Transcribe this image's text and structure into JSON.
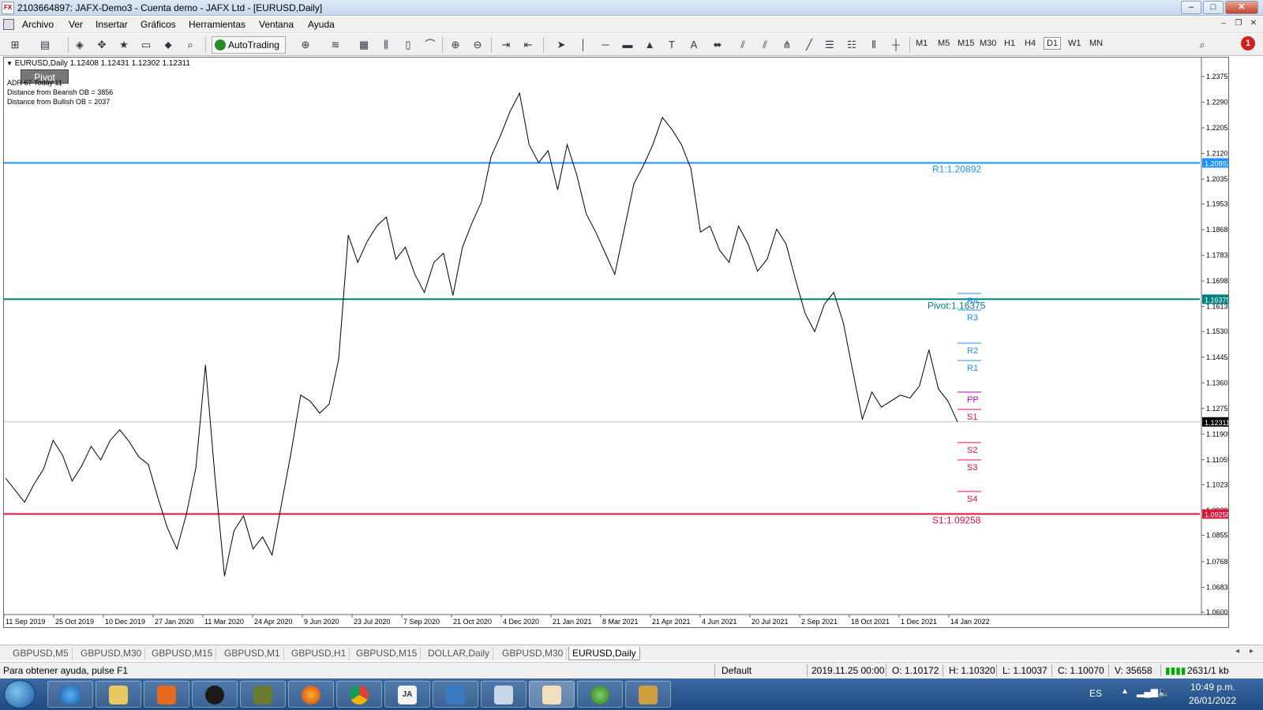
{
  "window": {
    "title": "2103664897: JAFX-Demo3 - Cuenta demo - JAFX Ltd - [EURUSD,Daily]",
    "app_icon_text": "FX"
  },
  "menu": [
    "Archivo",
    "Ver",
    "Insertar",
    "Gráficos",
    "Herramientas",
    "Ventana",
    "Ayuda"
  ],
  "toolbar": {
    "autotrading_label": "AutoTrading",
    "timeframes": [
      "M1",
      "M5",
      "M15",
      "M30",
      "H1",
      "H4",
      "D1",
      "W1",
      "MN"
    ],
    "active_timeframe": "D1",
    "alert_count": "1"
  },
  "chart": {
    "symbol_header": "EURUSD,Daily  1.12408 1.12431 1.12302 1.12311",
    "pivot_button": "Pivot",
    "adr_line": "ADR 67   Today 11",
    "bearish_ob_line": "Distance from Bearish OB = 3856",
    "bullish_ob_line": "Distance from Bullish OB = 2037",
    "price_badges": {
      "r1": "1.20892",
      "pivot": "1.16375",
      "current": "1.12311",
      "s1": "1.09258"
    },
    "labels": {
      "r1": "R1:1.20892",
      "pivot": "Pivot:1.16375",
      "s1": "S1:1.09258"
    },
    "level_tags": [
      "R4",
      "R3",
      "R2",
      "R1",
      "PP",
      "S1",
      "S2",
      "S3",
      "S4"
    ],
    "colors": {
      "r1_line": "#1e90ff",
      "pivot_line": "#008080",
      "s1_line": "#dc143c",
      "pp_tag": "#c000c0"
    }
  },
  "chart_data": {
    "type": "line",
    "title": "EURUSD,Daily",
    "xlabel": "",
    "ylabel": "",
    "x_tick_labels": [
      "11 Sep 2019",
      "25 Oct 2019",
      "10 Dec 2019",
      "27 Jan 2020",
      "11 Mar 2020",
      "24 Apr 2020",
      "9 Jun 2020",
      "23 Jul 2020",
      "7 Sep 2020",
      "21 Oct 2020",
      "4 Dec 2020",
      "21 Jan 2021",
      "8 Mar 2021",
      "21 Apr 2021",
      "4 Jun 2021",
      "20 Jul 2021",
      "2 Sep 2021",
      "18 Oct 2021",
      "1 Dec 2021",
      "14 Jan 2022"
    ],
    "y_tick_labels": [
      "1.23755",
      "1.22905",
      "1.22055",
      "1.21205",
      "1.20355",
      "1.19530",
      "1.18680",
      "1.17830",
      "1.16980",
      "1.16130",
      "1.15305",
      "1.14455",
      "1.13605",
      "1.12755",
      "1.11905",
      "1.11055",
      "1.10230",
      "1.09380",
      "1.08555",
      "1.07680",
      "1.06830",
      "1.06005"
    ],
    "ylim": [
      1.06005,
      1.23755
    ],
    "grid": false,
    "series": [
      {
        "values": [
          1.1045,
          1.1005,
          1.0965,
          1.1025,
          1.1075,
          1.117,
          1.112,
          1.1035,
          1.1085,
          1.115,
          1.1105,
          1.117,
          1.1205,
          1.1165,
          1.1115,
          1.109,
          1.098,
          1.088,
          1.081,
          1.0925,
          1.108,
          1.142,
          1.105,
          1.072,
          1.087,
          1.092,
          1.081,
          1.085,
          1.079,
          1.096,
          1.113,
          1.132,
          1.13,
          1.126,
          1.129,
          1.144,
          1.185,
          1.176,
          1.183,
          1.188,
          1.191,
          1.177,
          1.181,
          1.172,
          1.166,
          1.176,
          1.179,
          1.165,
          1.181,
          1.189,
          1.196,
          1.211,
          1.218,
          1.226,
          1.232,
          1.215,
          1.209,
          1.213,
          1.2,
          1.215,
          1.205,
          1.192,
          1.186,
          1.179,
          1.172,
          1.187,
          1.202,
          1.208,
          1.215,
          1.224,
          1.22,
          1.215,
          1.207,
          1.186,
          1.188,
          1.18,
          1.176,
          1.188,
          1.182,
          1.173,
          1.177,
          1.187,
          1.182,
          1.17,
          1.159,
          1.153,
          1.162,
          1.166,
          1.156,
          1.14,
          1.124,
          1.133,
          1.128,
          1.13,
          1.132,
          1.131,
          1.135,
          1.147,
          1.134,
          1.13,
          1.1231
        ]
      }
    ],
    "levels": {
      "R1": 1.20892,
      "Pivot": 1.16375,
      "S1": 1.09258,
      "current": 1.12311
    }
  },
  "tabs": [
    "GBPUSD,M5",
    "GBPUSD,M30",
    "GBPUSD,M15",
    "GBPUSD,M1",
    "GBPUSD,H1",
    "GBPUSD,M15",
    "DOLLAR,Daily",
    "GBPUSD,M30",
    "EURUSD,Daily"
  ],
  "active_tab": "EURUSD,Daily",
  "status": {
    "help": "Para obtener ayuda, pulse F1",
    "profile": "Default",
    "datetime": "2019.11.25 00:00",
    "open": "O: 1.10172",
    "high": "H: 1.10320",
    "low": "L: 1.10037",
    "close": "C: 1.10070",
    "volume": "V: 35658",
    "traffic": "2631/1 kb"
  },
  "taskbar": {
    "language": "ES",
    "time": "10:49 p.m.",
    "date": "26/01/2022"
  }
}
